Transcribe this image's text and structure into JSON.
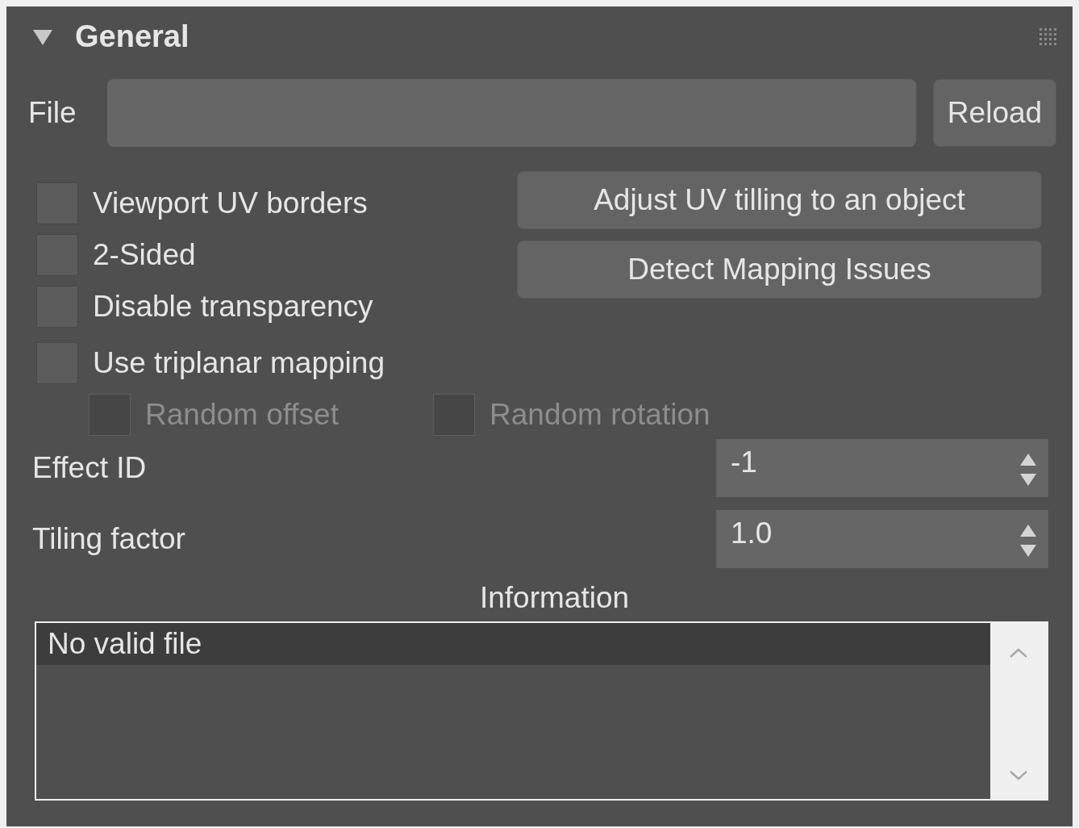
{
  "panel": {
    "title": "General",
    "expanded": true
  },
  "file": {
    "label": "File",
    "button": "Reload"
  },
  "checkboxes": [
    {
      "label": "Viewport UV borders",
      "checked": false,
      "disabled": false
    },
    {
      "label": "2-Sided",
      "checked": false,
      "disabled": false
    },
    {
      "label": "Disable transparency",
      "checked": false,
      "disabled": false
    },
    {
      "label": "Use triplanar mapping",
      "checked": false,
      "disabled": false
    }
  ],
  "sub_options": [
    {
      "label": "Random offset",
      "checked": false,
      "disabled": true
    },
    {
      "label": "Random rotation",
      "checked": false,
      "disabled": true
    }
  ],
  "actions": [
    "Adjust UV tilling to an object",
    "Detect Mapping Issues"
  ],
  "spinners": [
    {
      "label": "Effect ID",
      "value": "-1"
    },
    {
      "label": "Tiling factor",
      "value": "1.0"
    }
  ],
  "information": {
    "title": "Information",
    "items": [
      {
        "text": "No valid file",
        "selected": true
      }
    ]
  }
}
